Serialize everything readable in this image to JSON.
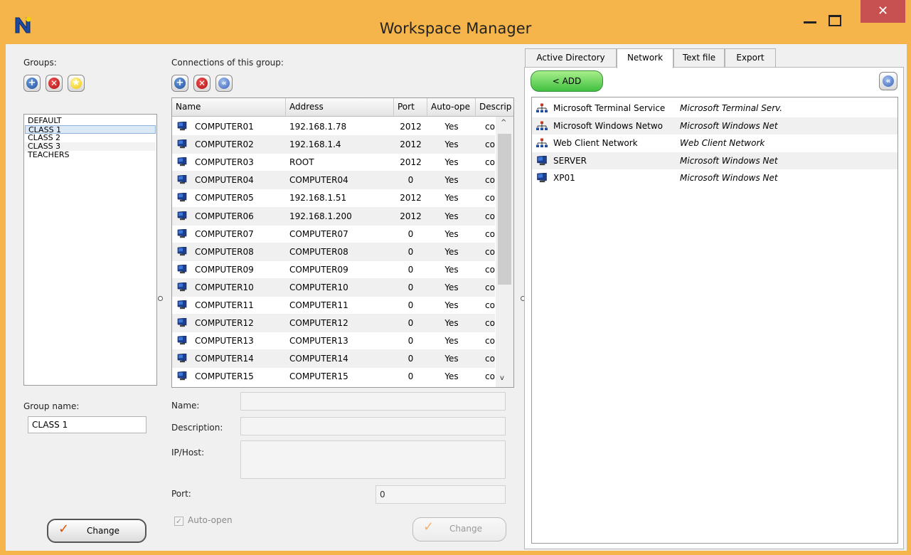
{
  "window": {
    "title": "Workspace Manager",
    "close_glyph": "✕"
  },
  "groups": {
    "label": "Groups:",
    "items": [
      "DEFAULT",
      "CLASS 1",
      "CLASS 2",
      "CLASS 3",
      "TEACHERS"
    ],
    "selected": "CLASS 1",
    "group_name_label": "Group name:",
    "group_name_value": "CLASS 1",
    "change_label": "Change"
  },
  "connections": {
    "label": "Connections of this group:",
    "columns": [
      "Name",
      "Address",
      "Port",
      "Auto-open",
      "Description"
    ],
    "column_headers_shown": [
      "Name",
      "Address",
      "Port",
      "Auto-ope",
      "Descrip"
    ],
    "rows": [
      {
        "name": "COMPUTER01",
        "address": "192.168.1.78",
        "port": "2012",
        "auto_open": "Yes",
        "desc": "co"
      },
      {
        "name": "COMPUTER02",
        "address": "192.168.1.4",
        "port": "2012",
        "auto_open": "Yes",
        "desc": "co"
      },
      {
        "name": "COMPUTER03",
        "address": "ROOT",
        "port": "2012",
        "auto_open": "Yes",
        "desc": "co"
      },
      {
        "name": "COMPUTER04",
        "address": "COMPUTER04",
        "port": "0",
        "auto_open": "Yes",
        "desc": "co"
      },
      {
        "name": "COMPUTER05",
        "address": "192.168.1.51",
        "port": "2012",
        "auto_open": "Yes",
        "desc": "co"
      },
      {
        "name": "COMPUTER06",
        "address": "192.168.1.200",
        "port": "2012",
        "auto_open": "Yes",
        "desc": "co"
      },
      {
        "name": "COMPUTER07",
        "address": "COMPUTER07",
        "port": "0",
        "auto_open": "Yes",
        "desc": "co"
      },
      {
        "name": "COMPUTER08",
        "address": "COMPUTER08",
        "port": "0",
        "auto_open": "Yes",
        "desc": "co"
      },
      {
        "name": "COMPUTER09",
        "address": "COMPUTER09",
        "port": "0",
        "auto_open": "Yes",
        "desc": "co"
      },
      {
        "name": "COMPUTER10",
        "address": "COMPUTER10",
        "port": "0",
        "auto_open": "Yes",
        "desc": "co"
      },
      {
        "name": "COMPUTER11",
        "address": "COMPUTER11",
        "port": "0",
        "auto_open": "Yes",
        "desc": "co"
      },
      {
        "name": "COMPUTER12",
        "address": "COMPUTER12",
        "port": "0",
        "auto_open": "Yes",
        "desc": "co"
      },
      {
        "name": "COMPUTER13",
        "address": "COMPUTER13",
        "port": "0",
        "auto_open": "Yes",
        "desc": "co"
      },
      {
        "name": "COMPUTER14",
        "address": "COMPUTER14",
        "port": "0",
        "auto_open": "Yes",
        "desc": "co"
      },
      {
        "name": "COMPUTER15",
        "address": "COMPUTER15",
        "port": "0",
        "auto_open": "Yes",
        "desc": "co"
      }
    ],
    "form": {
      "name_label": "Name:",
      "description_label": "Description:",
      "iphost_label": "IP/Host:",
      "port_label": "Port:",
      "port_value": "0",
      "autoopen_label": "Auto-open",
      "change_label": "Change"
    }
  },
  "right_panel": {
    "tabs": [
      "Active Directory",
      "Network",
      "Text file",
      "Export"
    ],
    "active_tab": "Network",
    "add_label": "< ADD",
    "items": [
      {
        "icon": "network-icon",
        "name": "Microsoft Terminal Service",
        "type": "Microsoft Terminal Serv."
      },
      {
        "icon": "network-icon",
        "name": "Microsoft Windows Netwo",
        "type": "Microsoft Windows Net"
      },
      {
        "icon": "network-icon",
        "name": "Web Client Network",
        "type": "Web Client Network"
      },
      {
        "icon": "computer-icon",
        "name": "SERVER",
        "type": "Microsoft Windows Net"
      },
      {
        "icon": "computer-icon",
        "name": "XP01",
        "type": "Microsoft Windows Net"
      }
    ]
  },
  "colors": {
    "titlebar": "#f6b54a",
    "close": "#c75050",
    "add_green": "#40c040",
    "selection": "#dbe8f5"
  }
}
